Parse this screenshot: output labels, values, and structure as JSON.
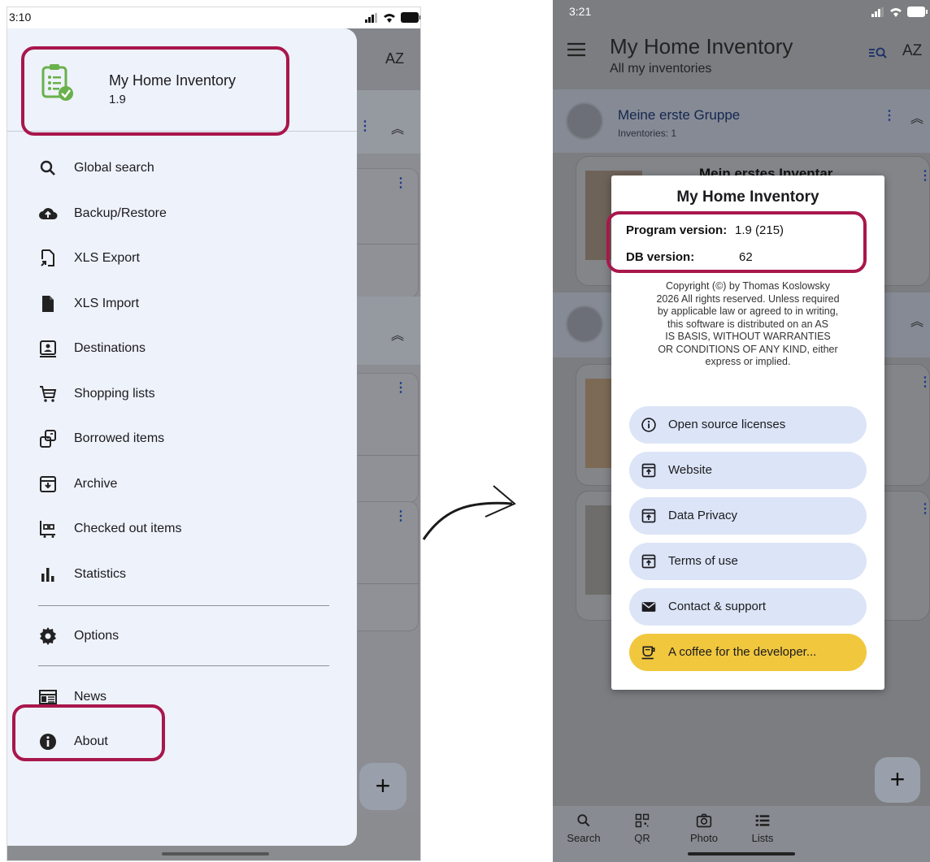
{
  "left_phone": {
    "status_time": "3:10",
    "background": {
      "sort_glyph": "AZ"
    },
    "drawer": {
      "app_title": "My Home Inventory",
      "app_version": "1.9",
      "items": [
        {
          "label": "Global search",
          "icon": "search-icon"
        },
        {
          "label": "Backup/Restore",
          "icon": "cloud-upload-icon"
        },
        {
          "label": "XLS Export",
          "icon": "file-export-icon"
        },
        {
          "label": "XLS Import",
          "icon": "file-icon"
        },
        {
          "label": "Destinations",
          "icon": "destination-icon"
        },
        {
          "label": "Shopping lists",
          "icon": "cart-icon"
        },
        {
          "label": "Borrowed items",
          "icon": "borrowed-icon"
        },
        {
          "label": "Archive",
          "icon": "archive-icon"
        },
        {
          "label": "Checked out items",
          "icon": "checked-out-icon"
        },
        {
          "label": "Statistics",
          "icon": "bar-chart-icon"
        },
        {
          "label": "Options",
          "icon": "gear-icon"
        },
        {
          "label": "News",
          "icon": "news-icon"
        },
        {
          "label": "About",
          "icon": "info-icon"
        }
      ]
    },
    "fab_label": "+"
  },
  "right_phone": {
    "status_time": "3:21",
    "title": "My Home Inventory",
    "subtitle": "All my inventories",
    "sort_glyph": "AZ",
    "group1": {
      "title": "Meine erste Gruppe",
      "subtitle": "Inventories: 1"
    },
    "card_partial_title": "Mein erstes Inventar",
    "fab_label": "+",
    "bottom_nav": [
      {
        "label": "Search",
        "icon": "search-icon"
      },
      {
        "label": "QR",
        "icon": "qr-icon"
      },
      {
        "label": "Photo",
        "icon": "camera-icon"
      },
      {
        "label": "Lists",
        "icon": "list-icon"
      }
    ]
  },
  "about_dialog": {
    "title": "My Home Inventory",
    "program_version_label": "Program version:",
    "program_version_value": "1.9 (215)",
    "db_version_label": "DB version:",
    "db_version_value": "62",
    "copyright_lines": [
      "Copyright (©) by Thomas Koslowsky",
      "2026 All rights reserved. Unless required",
      "by applicable law or agreed to in writing,",
      "this software is distributed on an AS",
      "IS BASIS, WITHOUT WARRANTIES",
      "OR CONDITIONS OF ANY KIND, either",
      "express or implied."
    ],
    "buttons": [
      {
        "label": "Open source licenses",
        "icon": "info-icon"
      },
      {
        "label": "Website",
        "icon": "open-link-icon"
      },
      {
        "label": "Data Privacy",
        "icon": "open-link-icon"
      },
      {
        "label": "Terms of use",
        "icon": "open-link-icon"
      },
      {
        "label": "Contact & support",
        "icon": "mail-icon"
      },
      {
        "label": "A coffee for the developer...",
        "icon": "coffee-icon"
      }
    ]
  },
  "colors": {
    "highlight": "#a8174c",
    "dialog_button": "#dce5f7",
    "coffee_button": "#f1c73e",
    "drawer_bg": "#eef2fa",
    "logo_green": "#6ab04c"
  }
}
